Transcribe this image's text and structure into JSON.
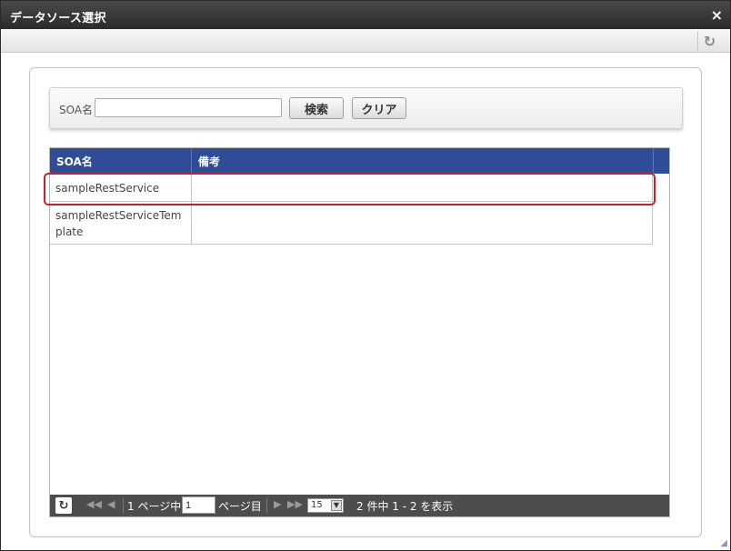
{
  "window": {
    "title": "データソース選択",
    "close_icon": "×"
  },
  "toolbar": {
    "refresh_icon": "↻"
  },
  "search": {
    "label": "SOA名",
    "value": "",
    "search_button": "検索",
    "clear_button": "クリア"
  },
  "grid": {
    "columns": [
      "SOA名",
      "備考"
    ],
    "rows": [
      {
        "name": "sampleRestService",
        "note": ""
      },
      {
        "name": "sampleRestServiceTemplate",
        "note": ""
      }
    ]
  },
  "pager": {
    "refresh_icon": "↻",
    "first_icon": "◀◀",
    "prev_icon": "◀",
    "page_prefix": "1 ページ中",
    "page_value": "1",
    "page_suffix": "ページ目",
    "next_icon": "▶",
    "last_icon": "▶▶",
    "rows_per_page": "15",
    "summary": "2 件中 1 - 2 を表示"
  },
  "colors": {
    "header_blue": "#2f4d97",
    "highlight_red": "#c8202a",
    "pager_bg": "#4d4d4d"
  }
}
